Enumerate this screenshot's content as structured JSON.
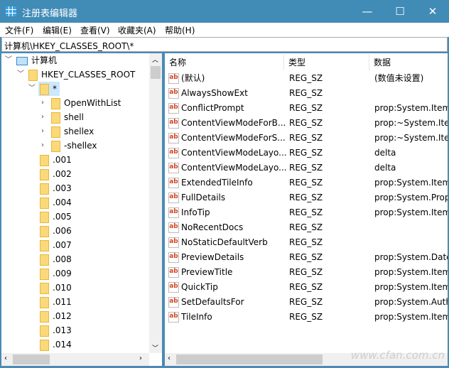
{
  "window": {
    "title": "注册表编辑器",
    "minimize": "—",
    "maximize": "☐",
    "close": "✕"
  },
  "menu": [
    "文件(F)",
    "编辑(E)",
    "查看(V)",
    "收藏夹(A)",
    "帮助(H)"
  ],
  "address": "计算机\\HKEY_CLASSES_ROOT\\*",
  "tree": {
    "computer": "计算机",
    "root": "HKEY_CLASSES_ROOT",
    "selected": "*",
    "children": [
      "OpenWithList",
      "shell",
      "shellex",
      "-shellex"
    ],
    "siblings": [
      ".001",
      ".002",
      ".003",
      ".004",
      ".005",
      ".006",
      ".007",
      ".008",
      ".009",
      ".010",
      ".011",
      ".012",
      ".013",
      ".014"
    ]
  },
  "columns": [
    "名称",
    "类型",
    "数据"
  ],
  "values": [
    {
      "name": "(默认)",
      "type": "REG_SZ",
      "data": "(数值未设置)"
    },
    {
      "name": "AlwaysShowExt",
      "type": "REG_SZ",
      "data": ""
    },
    {
      "name": "ConflictPrompt",
      "type": "REG_SZ",
      "data": "prop:System.Item"
    },
    {
      "name": "ContentViewModeForB...",
      "type": "REG_SZ",
      "data": "prop:~System.Iter"
    },
    {
      "name": "ContentViewModeForS...",
      "type": "REG_SZ",
      "data": "prop:~System.Iter"
    },
    {
      "name": "ContentViewModeLayo...",
      "type": "REG_SZ",
      "data": "delta"
    },
    {
      "name": "ContentViewModeLayo...",
      "type": "REG_SZ",
      "data": "delta"
    },
    {
      "name": "ExtendedTileInfo",
      "type": "REG_SZ",
      "data": "prop:System.Item"
    },
    {
      "name": "FullDetails",
      "type": "REG_SZ",
      "data": "prop:System.Prop"
    },
    {
      "name": "InfoTip",
      "type": "REG_SZ",
      "data": "prop:System.Item"
    },
    {
      "name": "NoRecentDocs",
      "type": "REG_SZ",
      "data": ""
    },
    {
      "name": "NoStaticDefaultVerb",
      "type": "REG_SZ",
      "data": ""
    },
    {
      "name": "PreviewDetails",
      "type": "REG_SZ",
      "data": "prop:System.Date"
    },
    {
      "name": "PreviewTitle",
      "type": "REG_SZ",
      "data": "prop:System.Item"
    },
    {
      "name": "QuickTip",
      "type": "REG_SZ",
      "data": "prop:System.Item"
    },
    {
      "name": "SetDefaultsFor",
      "type": "REG_SZ",
      "data": "prop:System.Auth"
    },
    {
      "name": "TileInfo",
      "type": "REG_SZ",
      "data": "prop:System.Item"
    }
  ],
  "value_icon": "ab",
  "watermark": "www.cfan.com.cn"
}
